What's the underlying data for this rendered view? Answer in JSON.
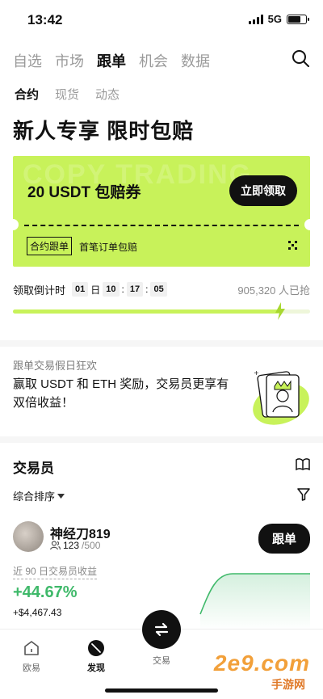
{
  "status_bar": {
    "time": "13:42",
    "network": "5G"
  },
  "top_tabs": [
    "自选",
    "市场",
    "跟单",
    "机会",
    "数据"
  ],
  "top_tabs_active": 2,
  "sub_tabs": [
    "合约",
    "现货",
    "动态"
  ],
  "sub_tabs_active": 0,
  "headline": "新人专享 限时包赔",
  "coupon": {
    "watermark": "COPY TRADING",
    "title": "20 USDT 包赔券",
    "claim_label": "立即领取",
    "tag": "合约跟单",
    "description": "首笔订单包赔",
    "accent_color": "#c8f25a"
  },
  "countdown": {
    "label": "领取倒计时",
    "days": "01",
    "day_unit": "日",
    "hours": "10",
    "minutes": "17",
    "seconds": "05",
    "separator": ":",
    "claimed": "905,320 人已抢",
    "progress": 0.9
  },
  "promo": {
    "label": "跟单交易假日狂欢",
    "text": "赢取 USDT 和 ETH 奖励，交易员更享有双倍收益！"
  },
  "traders_section": {
    "title": "交易员",
    "sort_label": "综合排序",
    "traders": [
      {
        "name": "神经刀819",
        "followers": "123",
        "max_followers": "/500",
        "follow_label": "跟单",
        "roi_label": "近 90 日交易员收益",
        "roi": "+44.67%",
        "pnl": "+$4,467.43",
        "roi_color": "#3fb96a"
      }
    ]
  },
  "bottom_nav": {
    "items": [
      "欧易",
      "发现",
      "交易"
    ],
    "active": 1
  },
  "watermark": {
    "text": "2e9.com",
    "sub": "手游网"
  }
}
